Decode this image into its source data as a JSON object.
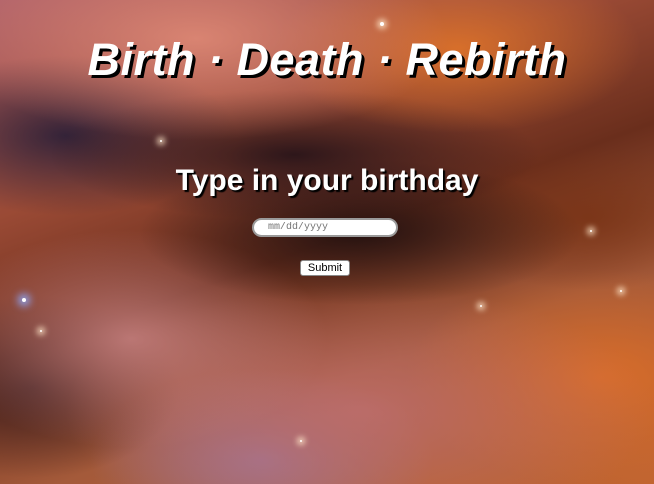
{
  "title": "Birth · Death · Rebirth",
  "prompt": "Type in your birthday",
  "birthday_input": {
    "placeholder": "mm/dd/yyyy",
    "value": ""
  },
  "submit_label": "Submit"
}
